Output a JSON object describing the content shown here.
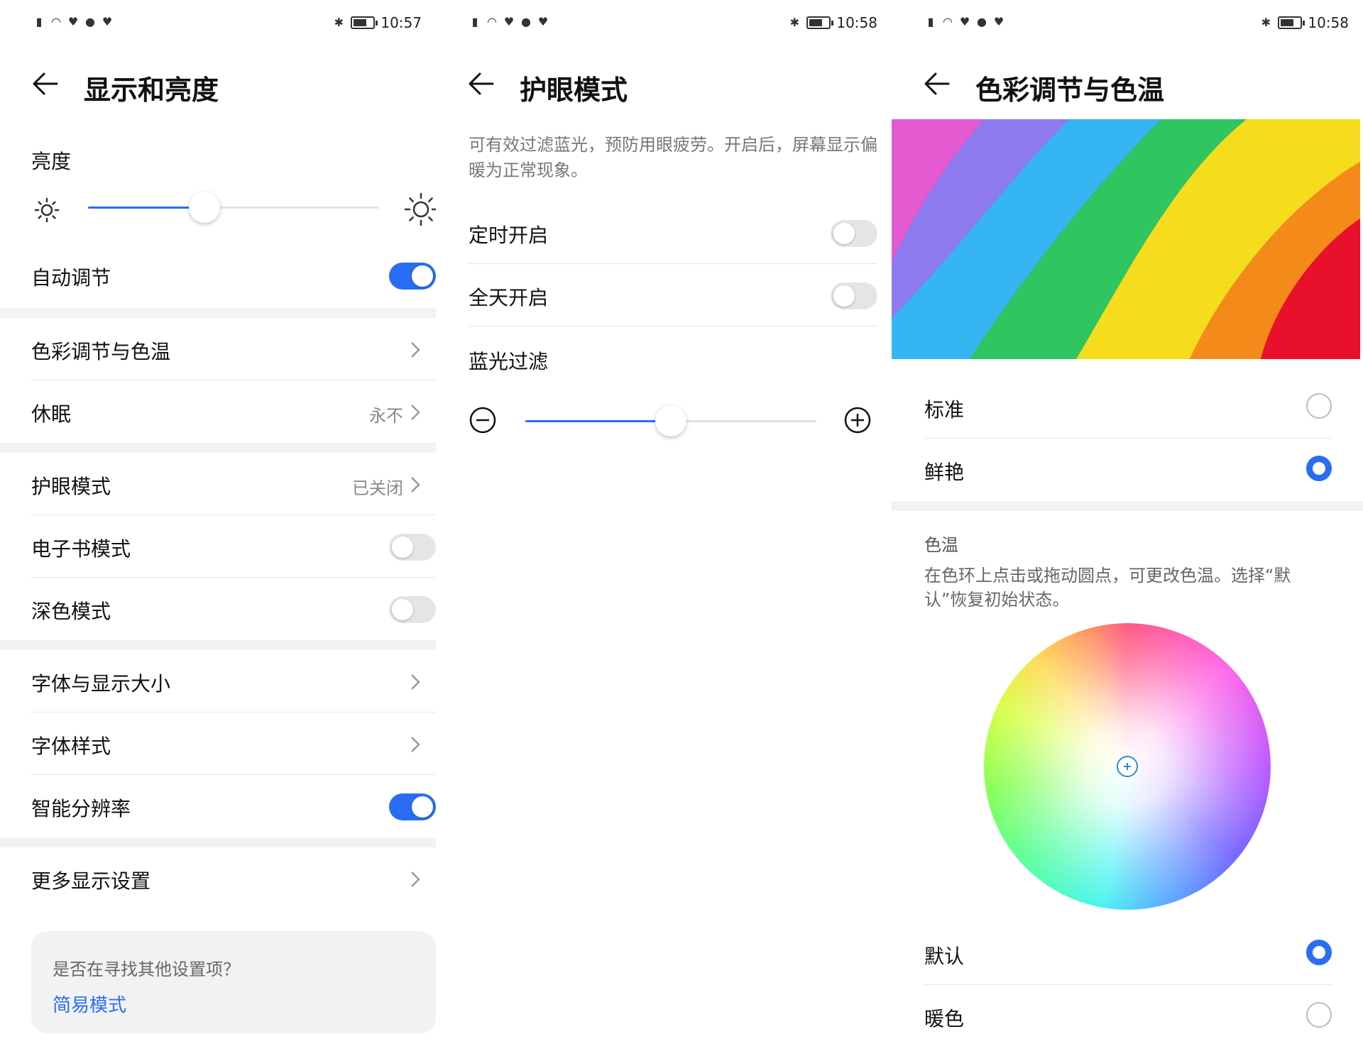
{
  "panels": [
    {
      "status": {
        "time": "10:57"
      },
      "title": "显示和亮度",
      "brightness": {
        "label": "亮度",
        "level_fraction": 0.4
      },
      "auto_adjust": {
        "label": "自动调节",
        "on": true
      },
      "items": {
        "color_temp": {
          "label": "色彩调节与色温"
        },
        "sleep": {
          "label": "休眠",
          "value": "永不"
        },
        "eye_comfort": {
          "label": "护眼模式",
          "value": "已关闭"
        },
        "ebook": {
          "label": "电子书模式",
          "on": false
        },
        "dark": {
          "label": "深色模式",
          "on": false
        },
        "font_size": {
          "label": "字体与显示大小"
        },
        "font_style": {
          "label": "字体样式"
        },
        "smart_res": {
          "label": "智能分辨率",
          "on": true
        },
        "more": {
          "label": "更多显示设置"
        }
      },
      "hint": {
        "question": "是否在寻找其他设置项？",
        "link": "简易模式"
      }
    },
    {
      "status": {
        "time": "10:58"
      },
      "title": "护眼模式",
      "description": "可有效过滤蓝光，预防用眼疲劳。开启后，屏幕显示偏暖为正常现象。",
      "scheduled": {
        "label": "定时开启",
        "on": false
      },
      "all_day": {
        "label": "全天开启",
        "on": false
      },
      "blue_filter": {
        "label": "蓝光过滤",
        "level_fraction": 0.5
      }
    },
    {
      "status": {
        "time": "10:58"
      },
      "title": "色彩调节与色温",
      "modes": [
        {
          "label": "标准",
          "selected": false
        },
        {
          "label": "鲜艳",
          "selected": true
        }
      ],
      "color_temp": {
        "heading": "色温",
        "description": "在色环上点击或拖动圆点，可更改色温。选择“默认”恢复初始状态。",
        "options": [
          {
            "label": "默认",
            "selected": true
          },
          {
            "label": "暖色",
            "selected": false
          }
        ]
      }
    }
  ],
  "colors": {
    "accent": "#2a6df4",
    "divider": "#e6e6e6",
    "section_bg": "#f2f2f2"
  }
}
